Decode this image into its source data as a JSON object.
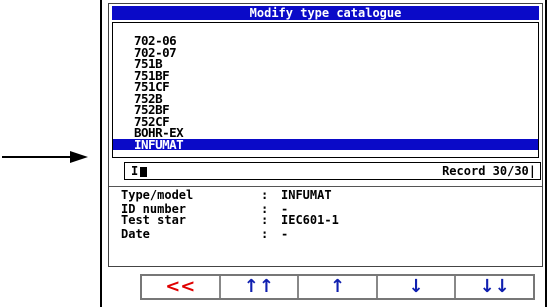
{
  "window": {
    "title": "Modify type catalogue"
  },
  "type_list": [
    {
      "label": "702-06",
      "selected": false
    },
    {
      "label": "702-07",
      "selected": false
    },
    {
      "label": "751B",
      "selected": false
    },
    {
      "label": "751BF",
      "selected": false
    },
    {
      "label": "751CF",
      "selected": false
    },
    {
      "label": "752B",
      "selected": false
    },
    {
      "label": "752BF",
      "selected": false
    },
    {
      "label": "752CF",
      "selected": false
    },
    {
      "label": "BOHR-EX",
      "selected": false
    },
    {
      "label": "INFUMAT",
      "selected": true
    }
  ],
  "status": {
    "input_value": "I",
    "record": "Record 30/30|"
  },
  "details": [
    {
      "label": "Type/model",
      "separator": ":",
      "value": "INFUMAT"
    },
    {
      "label": "ID number",
      "separator": ":",
      "value": "-"
    },
    {
      "label": "Test star",
      "separator": ":",
      "value": "IEC601-1"
    },
    {
      "label": "Date",
      "separator": ":",
      "value": "-"
    }
  ],
  "nav_buttons": [
    {
      "glyph": "<<",
      "icon": "back-icon",
      "color": "#e00000"
    },
    {
      "glyph": "↑↑",
      "icon": "page-up-icon",
      "color": "#1020b0"
    },
    {
      "glyph": "↑",
      "icon": "up-icon",
      "color": "#1020b0"
    },
    {
      "glyph": "↓",
      "icon": "down-icon",
      "color": "#1020b0"
    },
    {
      "glyph": "↓↓",
      "icon": "page-down-icon",
      "color": "#1020b0"
    }
  ],
  "colors": {
    "accent": "#0a0ac8",
    "back_button": "#e00000",
    "nav_arrows": "#1020b0"
  }
}
